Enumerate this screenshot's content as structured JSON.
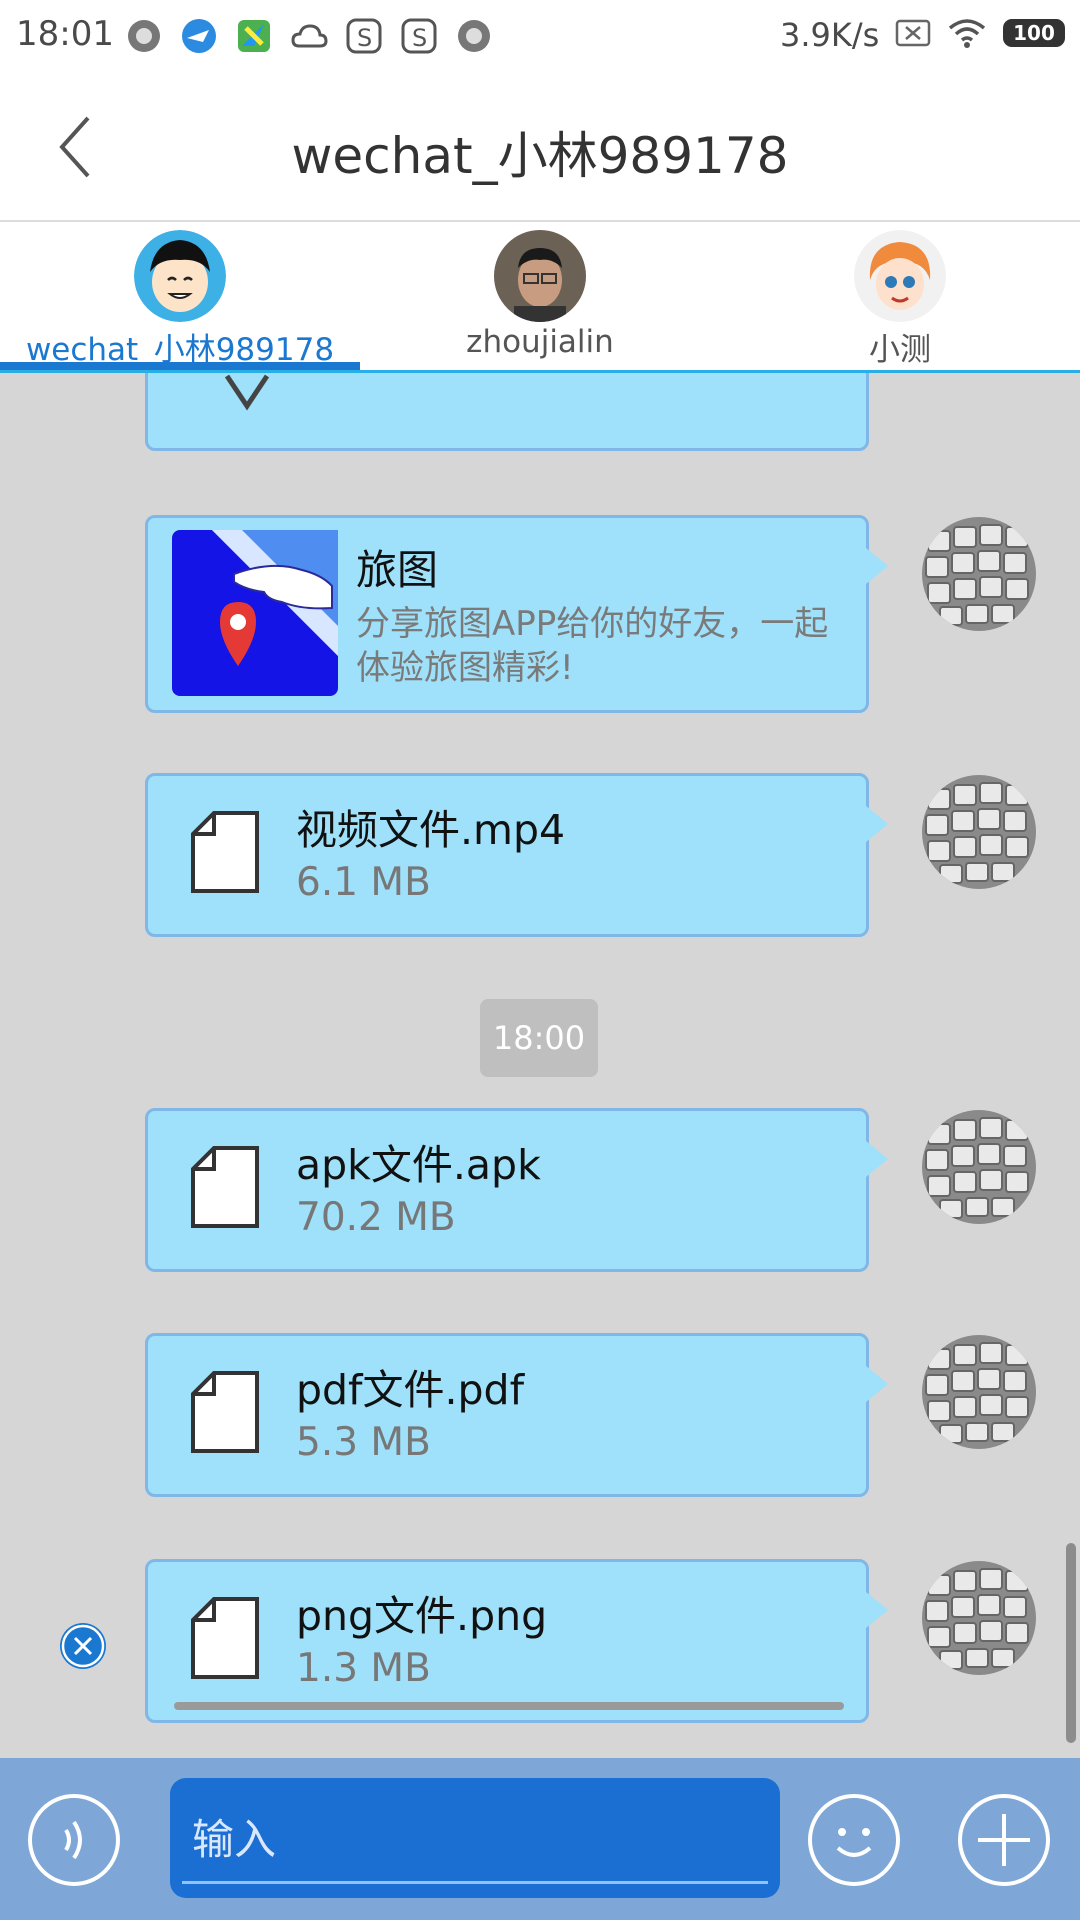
{
  "status_bar": {
    "time": "18:01",
    "network_speed": "3.9K/s",
    "battery": "100",
    "icons": [
      "record-icon",
      "plane-app-icon",
      "maps-app-icon",
      "cloud-icon",
      "s-app-icon",
      "s-app-icon",
      "record-icon"
    ]
  },
  "header": {
    "title": "wechat_小林989178"
  },
  "tabs": [
    {
      "label": "wechat_小林989178",
      "active": true
    },
    {
      "label": "zhoujialin",
      "active": false
    },
    {
      "label": "小测",
      "active": false
    }
  ],
  "messages": {
    "share": {
      "title": "旅图",
      "description": "分享旅图APP给你的好友，一起体验旅图精彩!"
    },
    "files": [
      {
        "name": "视频文件.mp4",
        "size": "6.1 MB"
      },
      {
        "name": "apk文件.apk",
        "size": "70.2 MB"
      },
      {
        "name": "pdf文件.pdf",
        "size": "5.3 MB"
      },
      {
        "name": "png文件.png",
        "size": "1.3 MB"
      }
    ],
    "timestamp": "18:00"
  },
  "composer": {
    "placeholder": "输入"
  },
  "colors": {
    "bubble": "#9fe1fa",
    "bubble_border": "#7fb7e8",
    "accent": "#1b78d0",
    "bottom_bar": "#7ea6d7",
    "input": "#1b6fd2",
    "chat_bg": "#d6d6d6"
  }
}
